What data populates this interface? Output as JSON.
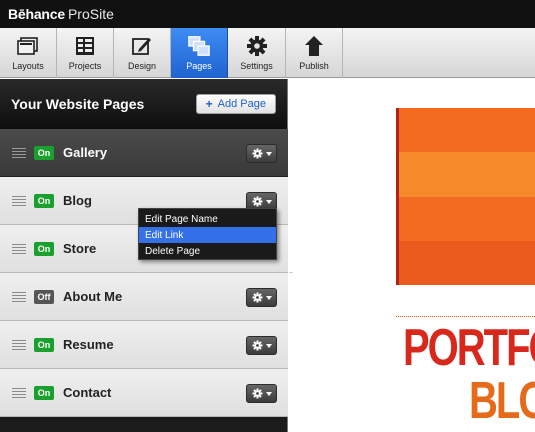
{
  "brand": {
    "strong": "Bēhance",
    "light": "ProSite"
  },
  "toolbar": {
    "items": [
      {
        "label": "Layouts",
        "icon": "layouts-icon"
      },
      {
        "label": "Projects",
        "icon": "projects-icon"
      },
      {
        "label": "Design",
        "icon": "design-icon"
      },
      {
        "label": "Pages",
        "icon": "pages-icon",
        "active": true
      },
      {
        "label": "Settings",
        "icon": "settings-icon"
      },
      {
        "label": "Publish",
        "icon": "publish-icon"
      }
    ],
    "active_color": "#2a74e0"
  },
  "panel": {
    "title": "Your Website Pages",
    "add_button": "Add Page",
    "pages": [
      {
        "label": "Gallery",
        "status": "On",
        "selected": true
      },
      {
        "label": "Blog",
        "status": "On"
      },
      {
        "label": "Store",
        "status": "On"
      },
      {
        "label": "About Me",
        "status": "Off"
      },
      {
        "label": "Resume",
        "status": "On"
      },
      {
        "label": "Contact",
        "status": "On"
      }
    ]
  },
  "menu": {
    "items": [
      "Edit Page Name",
      "Edit Link",
      "Delete Page"
    ],
    "highlighted": "Edit Link"
  },
  "preview": {
    "heading_1": "PORTFOLIO",
    "heading_2": "BLOG",
    "bands": [
      "#f26b21",
      "#f58a2b",
      "#f26b21",
      "#ea5a1c"
    ]
  }
}
